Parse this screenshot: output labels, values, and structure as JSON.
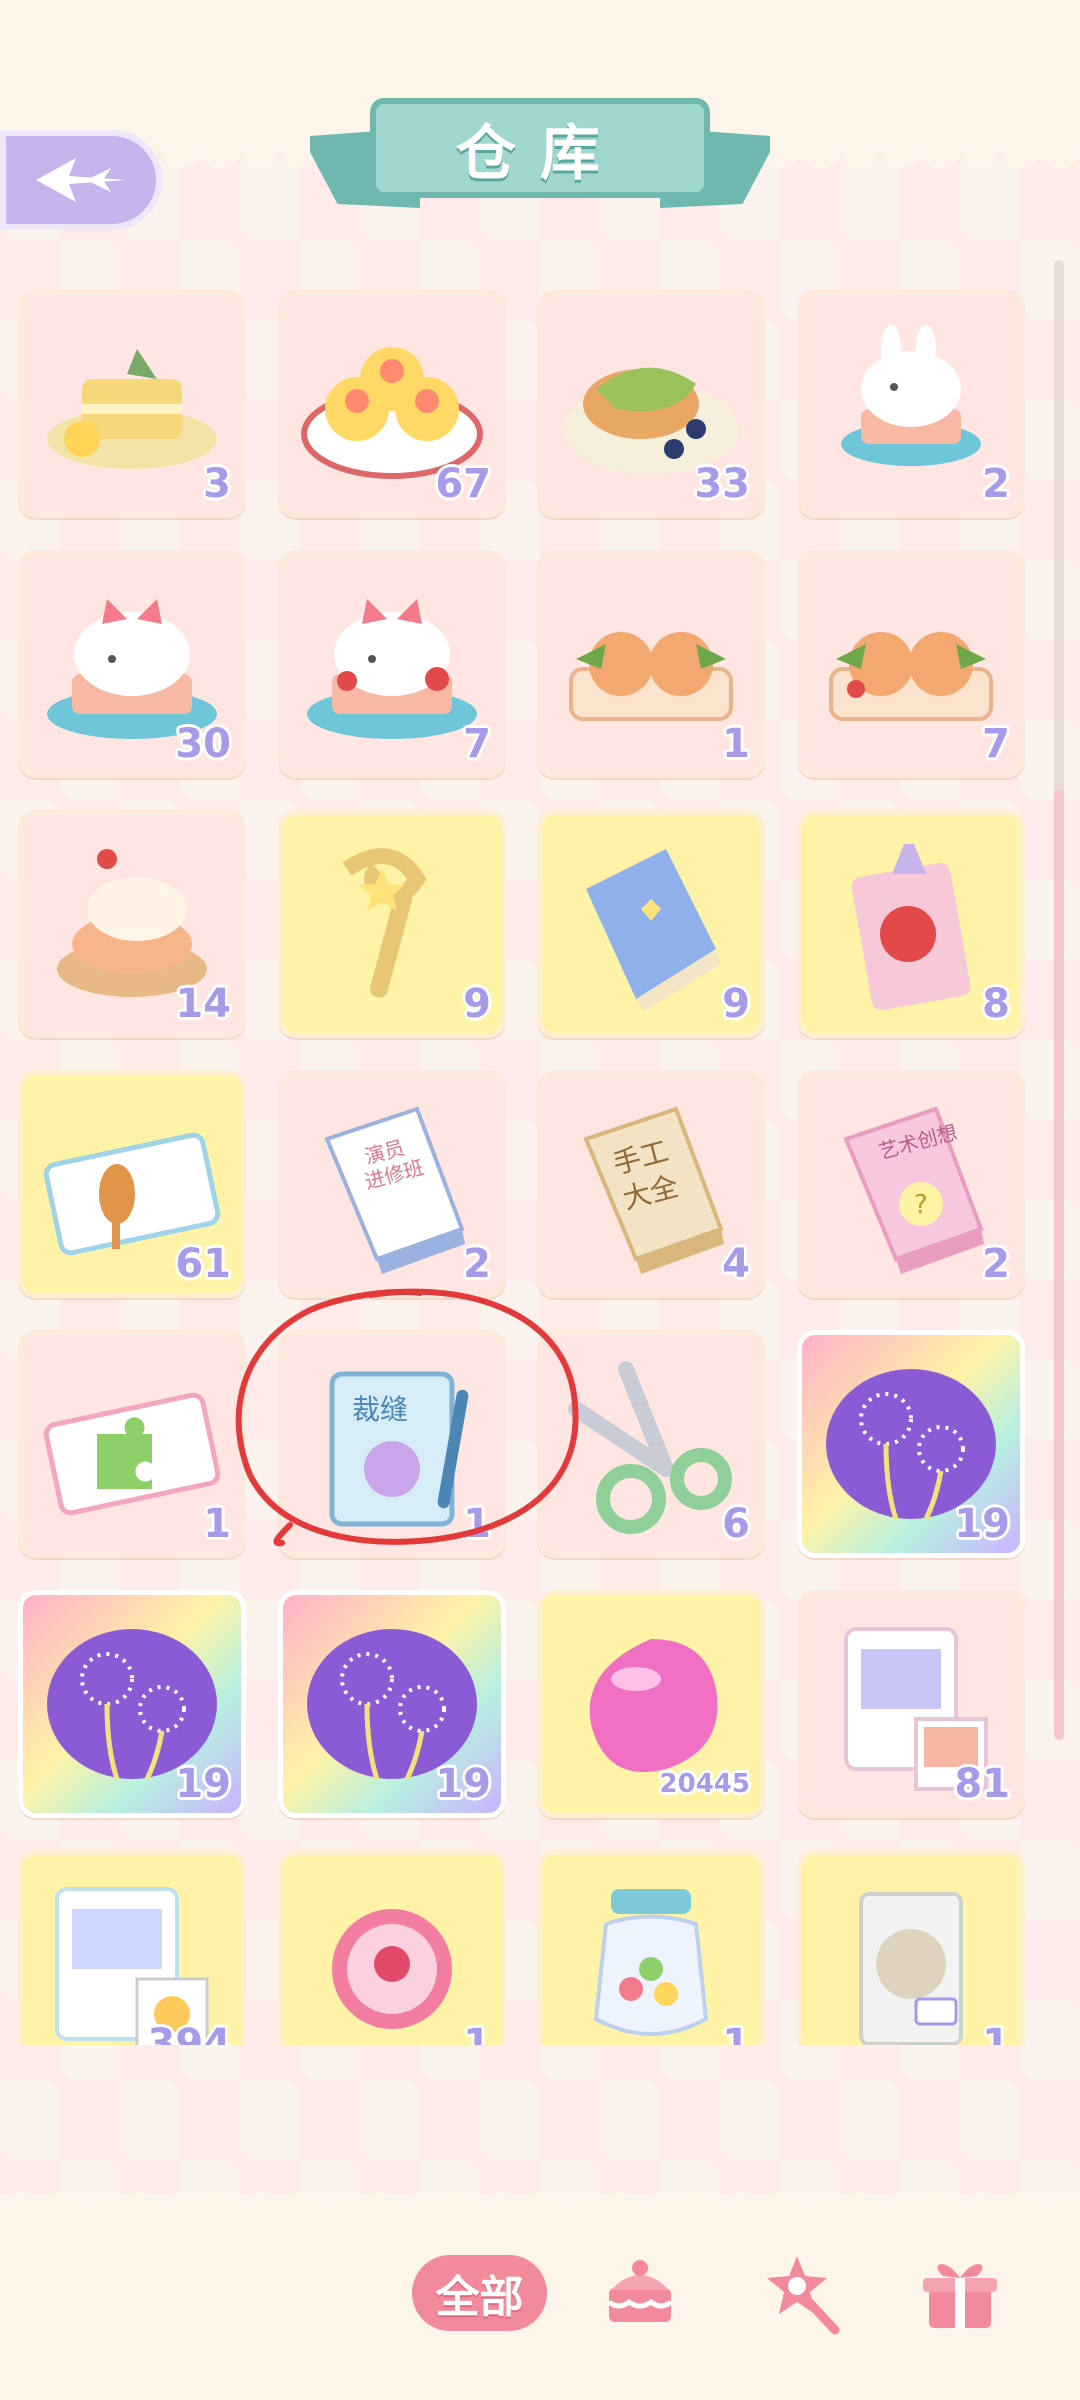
{
  "title": "仓库",
  "tabs": {
    "all_label": "全部"
  },
  "items": [
    {
      "count": "3",
      "icon": "cake-slice-icon",
      "bg": "pink"
    },
    {
      "count": "67",
      "icon": "shrimp-dumplings-icon",
      "bg": "pink"
    },
    {
      "count": "33",
      "icon": "matcha-pancake-icon",
      "bg": "pink"
    },
    {
      "count": "2",
      "icon": "bunny-cake-icon",
      "bg": "pink"
    },
    {
      "count": "30",
      "icon": "bunny-bow-cake-icon",
      "bg": "pink"
    },
    {
      "count": "7",
      "icon": "bunny-strawberry-cake-icon",
      "bg": "pink"
    },
    {
      "count": "1",
      "icon": "rose-pastry-tray-icon",
      "bg": "pink"
    },
    {
      "count": "7",
      "icon": "rose-pastry-plate-icon",
      "bg": "pink"
    },
    {
      "count": "14",
      "icon": "cream-puff-icon",
      "bg": "pink"
    },
    {
      "count": "9",
      "icon": "golden-wand-icon",
      "bg": "yellow"
    },
    {
      "count": "9",
      "icon": "blue-book-icon",
      "bg": "yellow"
    },
    {
      "count": "8",
      "icon": "apple-card-icon",
      "bg": "yellow"
    },
    {
      "count": "61",
      "icon": "ticket-icon",
      "bg": "yellow"
    },
    {
      "count": "2",
      "icon": "actor-book-icon",
      "bg": "pink"
    },
    {
      "count": "4",
      "icon": "handcraft-book-icon",
      "bg": "pink"
    },
    {
      "count": "2",
      "icon": "art-book-icon",
      "bg": "pink"
    },
    {
      "count": "1",
      "icon": "puzzle-ticket-icon",
      "bg": "pink"
    },
    {
      "count": "1",
      "icon": "sewing-notebook-icon",
      "bg": "pink"
    },
    {
      "count": "6",
      "icon": "scissors-icon",
      "bg": "pink"
    },
    {
      "count": "19",
      "icon": "firework-card-icon",
      "bg": "rainbow"
    },
    {
      "count": "19",
      "icon": "firework-card-icon",
      "bg": "rainbow"
    },
    {
      "count": "19",
      "icon": "firework-card-icon",
      "bg": "rainbow"
    },
    {
      "count": "20445",
      "icon": "pink-gem-icon",
      "bg": "yellow"
    },
    {
      "count": "81",
      "icon": "photo-pack-icon",
      "bg": "pink"
    },
    {
      "count": "394",
      "icon": "sticker-pack-icon",
      "bg": "yellow"
    },
    {
      "count": "1",
      "icon": "badge-icon",
      "bg": "yellow"
    },
    {
      "count": "1",
      "icon": "candy-jar-icon",
      "bg": "yellow"
    },
    {
      "count": "1",
      "icon": "bag-icon",
      "bg": "yellow"
    }
  ],
  "book_labels": {
    "actor": "演员进修班",
    "handcraft": "手工大全",
    "art": "艺术创想",
    "sewing": "裁缝"
  },
  "colors": {
    "accent": "#f28a9b",
    "count_text": "#a79ae8",
    "banner": "#9fd6cf",
    "annotation": "#e23a3a"
  }
}
